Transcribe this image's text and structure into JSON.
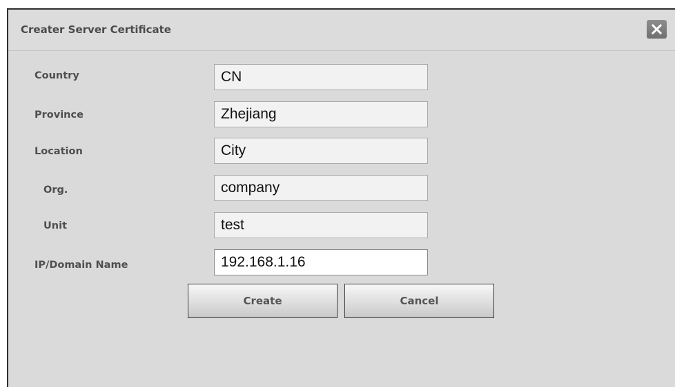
{
  "dialog": {
    "title": "Creater Server Certificate",
    "close_icon": "close-icon"
  },
  "form": {
    "fields": [
      {
        "label": "Country",
        "value": "CN"
      },
      {
        "label": "Province",
        "value": "Zhejiang"
      },
      {
        "label": "Location",
        "value": "City"
      },
      {
        "label": "Org.",
        "value": "company"
      },
      {
        "label": "Unit",
        "value": "test"
      },
      {
        "label": "IP/Domain Name",
        "value": "192.168.1.16"
      }
    ]
  },
  "buttons": {
    "create_label": "Create",
    "cancel_label": "Cancel"
  }
}
